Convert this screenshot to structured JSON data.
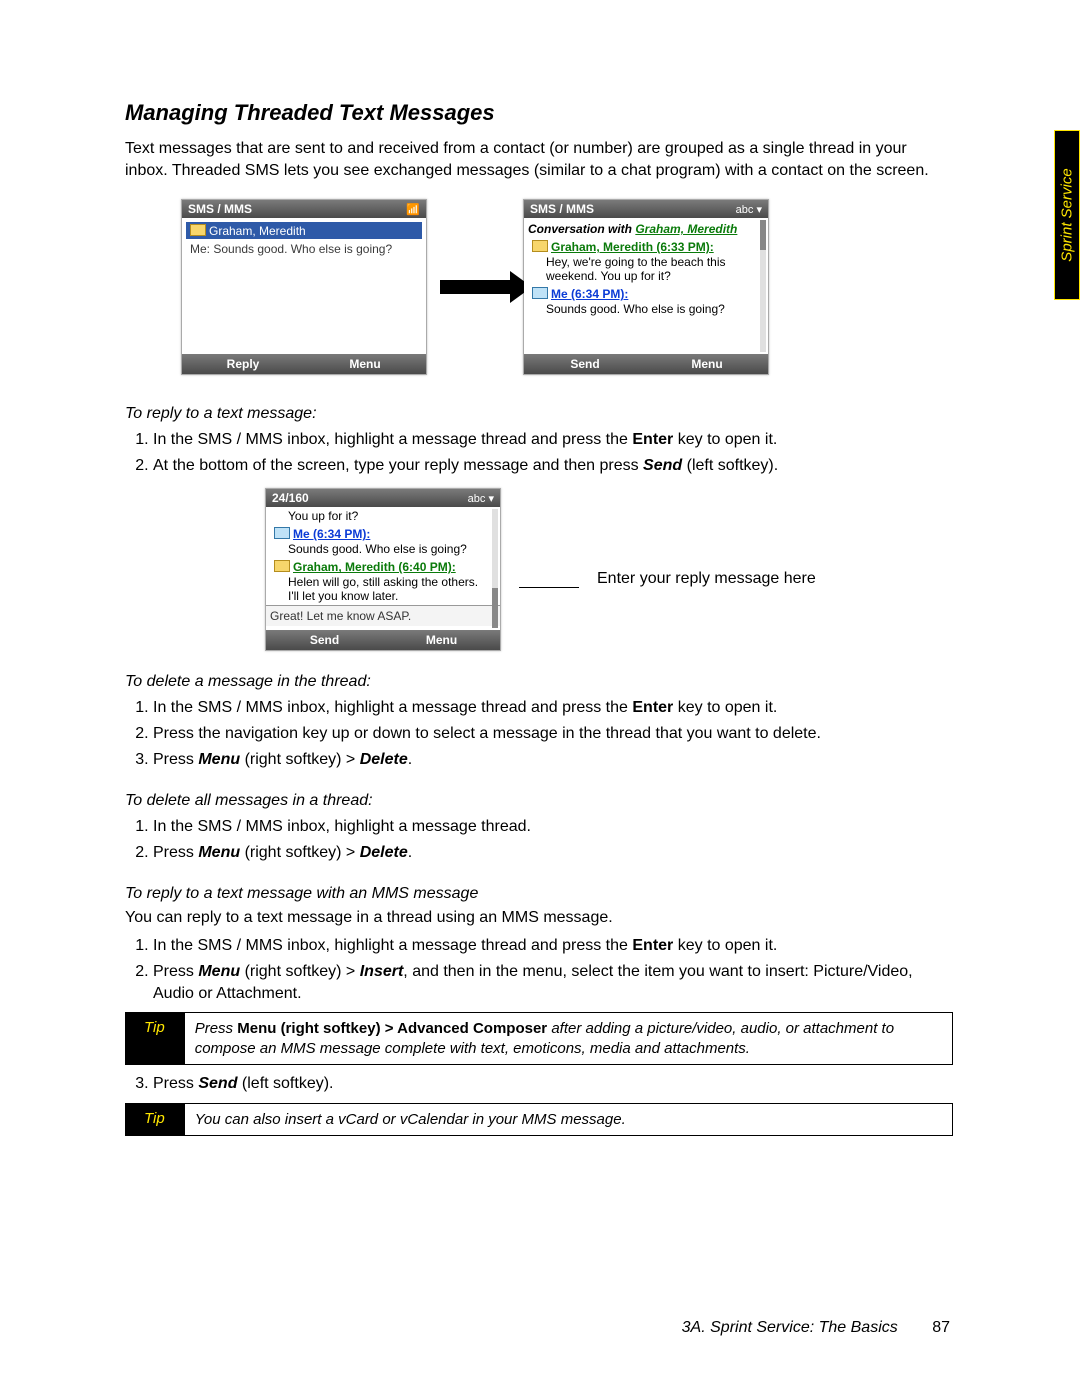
{
  "section": {
    "title": "Managing Threaded Text Messages",
    "intro": "Text messages that are sent to and received from a contact (or number) are grouped as a single thread in your inbox. Threaded SMS lets you see exchanged messages (similar to a chat program) with a contact on the screen."
  },
  "sideTab": "Sprint Service",
  "screens": {
    "left": {
      "title": "SMS / MMS",
      "indicator": "📶",
      "contact": "Graham, Meredith",
      "preview": "Me: Sounds good. Who else is going?",
      "softLeft": "Reply",
      "softRight": "Menu"
    },
    "right": {
      "title": "SMS / MMS",
      "indicator": "abc ▾",
      "convPrefix": "Conversation with ",
      "convName": "Graham, Meredith",
      "msg1Sender": "Graham, Meredith (6:33 PM):",
      "msg1Body": "Hey, we're going to the beach this weekend. You up for it?",
      "msg2Sender": "Me (6:34 PM):",
      "msg2Body": "Sounds good. Who else is going?",
      "softLeft": "Send",
      "softRight": "Menu"
    }
  },
  "replySection": {
    "head": "To reply to a text message:",
    "step1a": "In the SMS / MMS inbox, highlight a message thread and press the ",
    "step1b": "Enter",
    "step1c": " key to open it.",
    "step2a": "At the bottom of the screen, type your reply message and then press ",
    "step2b": "Send",
    "step2c": " (left softkey).",
    "fig": {
      "title": "24/160",
      "indicator": "abc ▾",
      "line0": "You up for it?",
      "s1": "Me (6:34 PM):",
      "m1": "Sounds good. Who else is going?",
      "s2": "Graham, Meredith (6:40 PM):",
      "m2": "Helen will go, still asking the others. I'll let you know later.",
      "input": "Great! Let me know ASAP.",
      "softLeft": "Send",
      "softRight": "Menu",
      "caption": "Enter your reply message here"
    }
  },
  "deleteOne": {
    "head": "To delete a message in the thread:",
    "step1a": "In the SMS / MMS inbox, highlight a message thread and press the ",
    "step1b": "Enter",
    "step1c": " key to open it.",
    "step2": "Press the navigation key up or down to select a message in the thread that you want to delete.",
    "step3a": "Press ",
    "step3b": "Menu",
    "step3c": " (right softkey) > ",
    "step3d": "Delete",
    "step3e": "."
  },
  "deleteAll": {
    "head": "To delete all messages in a thread:",
    "step1": "In the SMS / MMS inbox, highlight a message thread.",
    "step2a": "Press ",
    "step2b": "Menu",
    "step2c": " (right softkey) > ",
    "step2d": "Delete",
    "step2e": "."
  },
  "mmsReply": {
    "head": "To reply to a text message with an MMS message",
    "intro": "You can reply to a text message in a thread using an MMS message.",
    "step1a": "In the SMS / MMS inbox, highlight a message thread and press the ",
    "step1b": "Enter",
    "step1c": " key to open it.",
    "step2a": "Press ",
    "step2b": "Menu",
    "step2c": " (right softkey) > ",
    "step2d": "Insert",
    "step2e": ", and then in the menu, select the item you want to insert: Picture/Video, Audio or Attachment.",
    "tip1Label": "Tip",
    "tip1a": "Press ",
    "tip1b": "Menu (right softkey) > Advanced Composer",
    "tip1c": " after adding a picture/video, audio, or attachment to compose an MMS message complete with text, emoticons, media and attachments.",
    "step3a": "Press ",
    "step3b": "Send",
    "step3c": " (left softkey).",
    "tip2Label": "Tip",
    "tip2": "You can also insert a vCard or vCalendar in your MMS message."
  },
  "footer": {
    "chapter": "3A. Sprint Service: The Basics",
    "page": "87"
  }
}
